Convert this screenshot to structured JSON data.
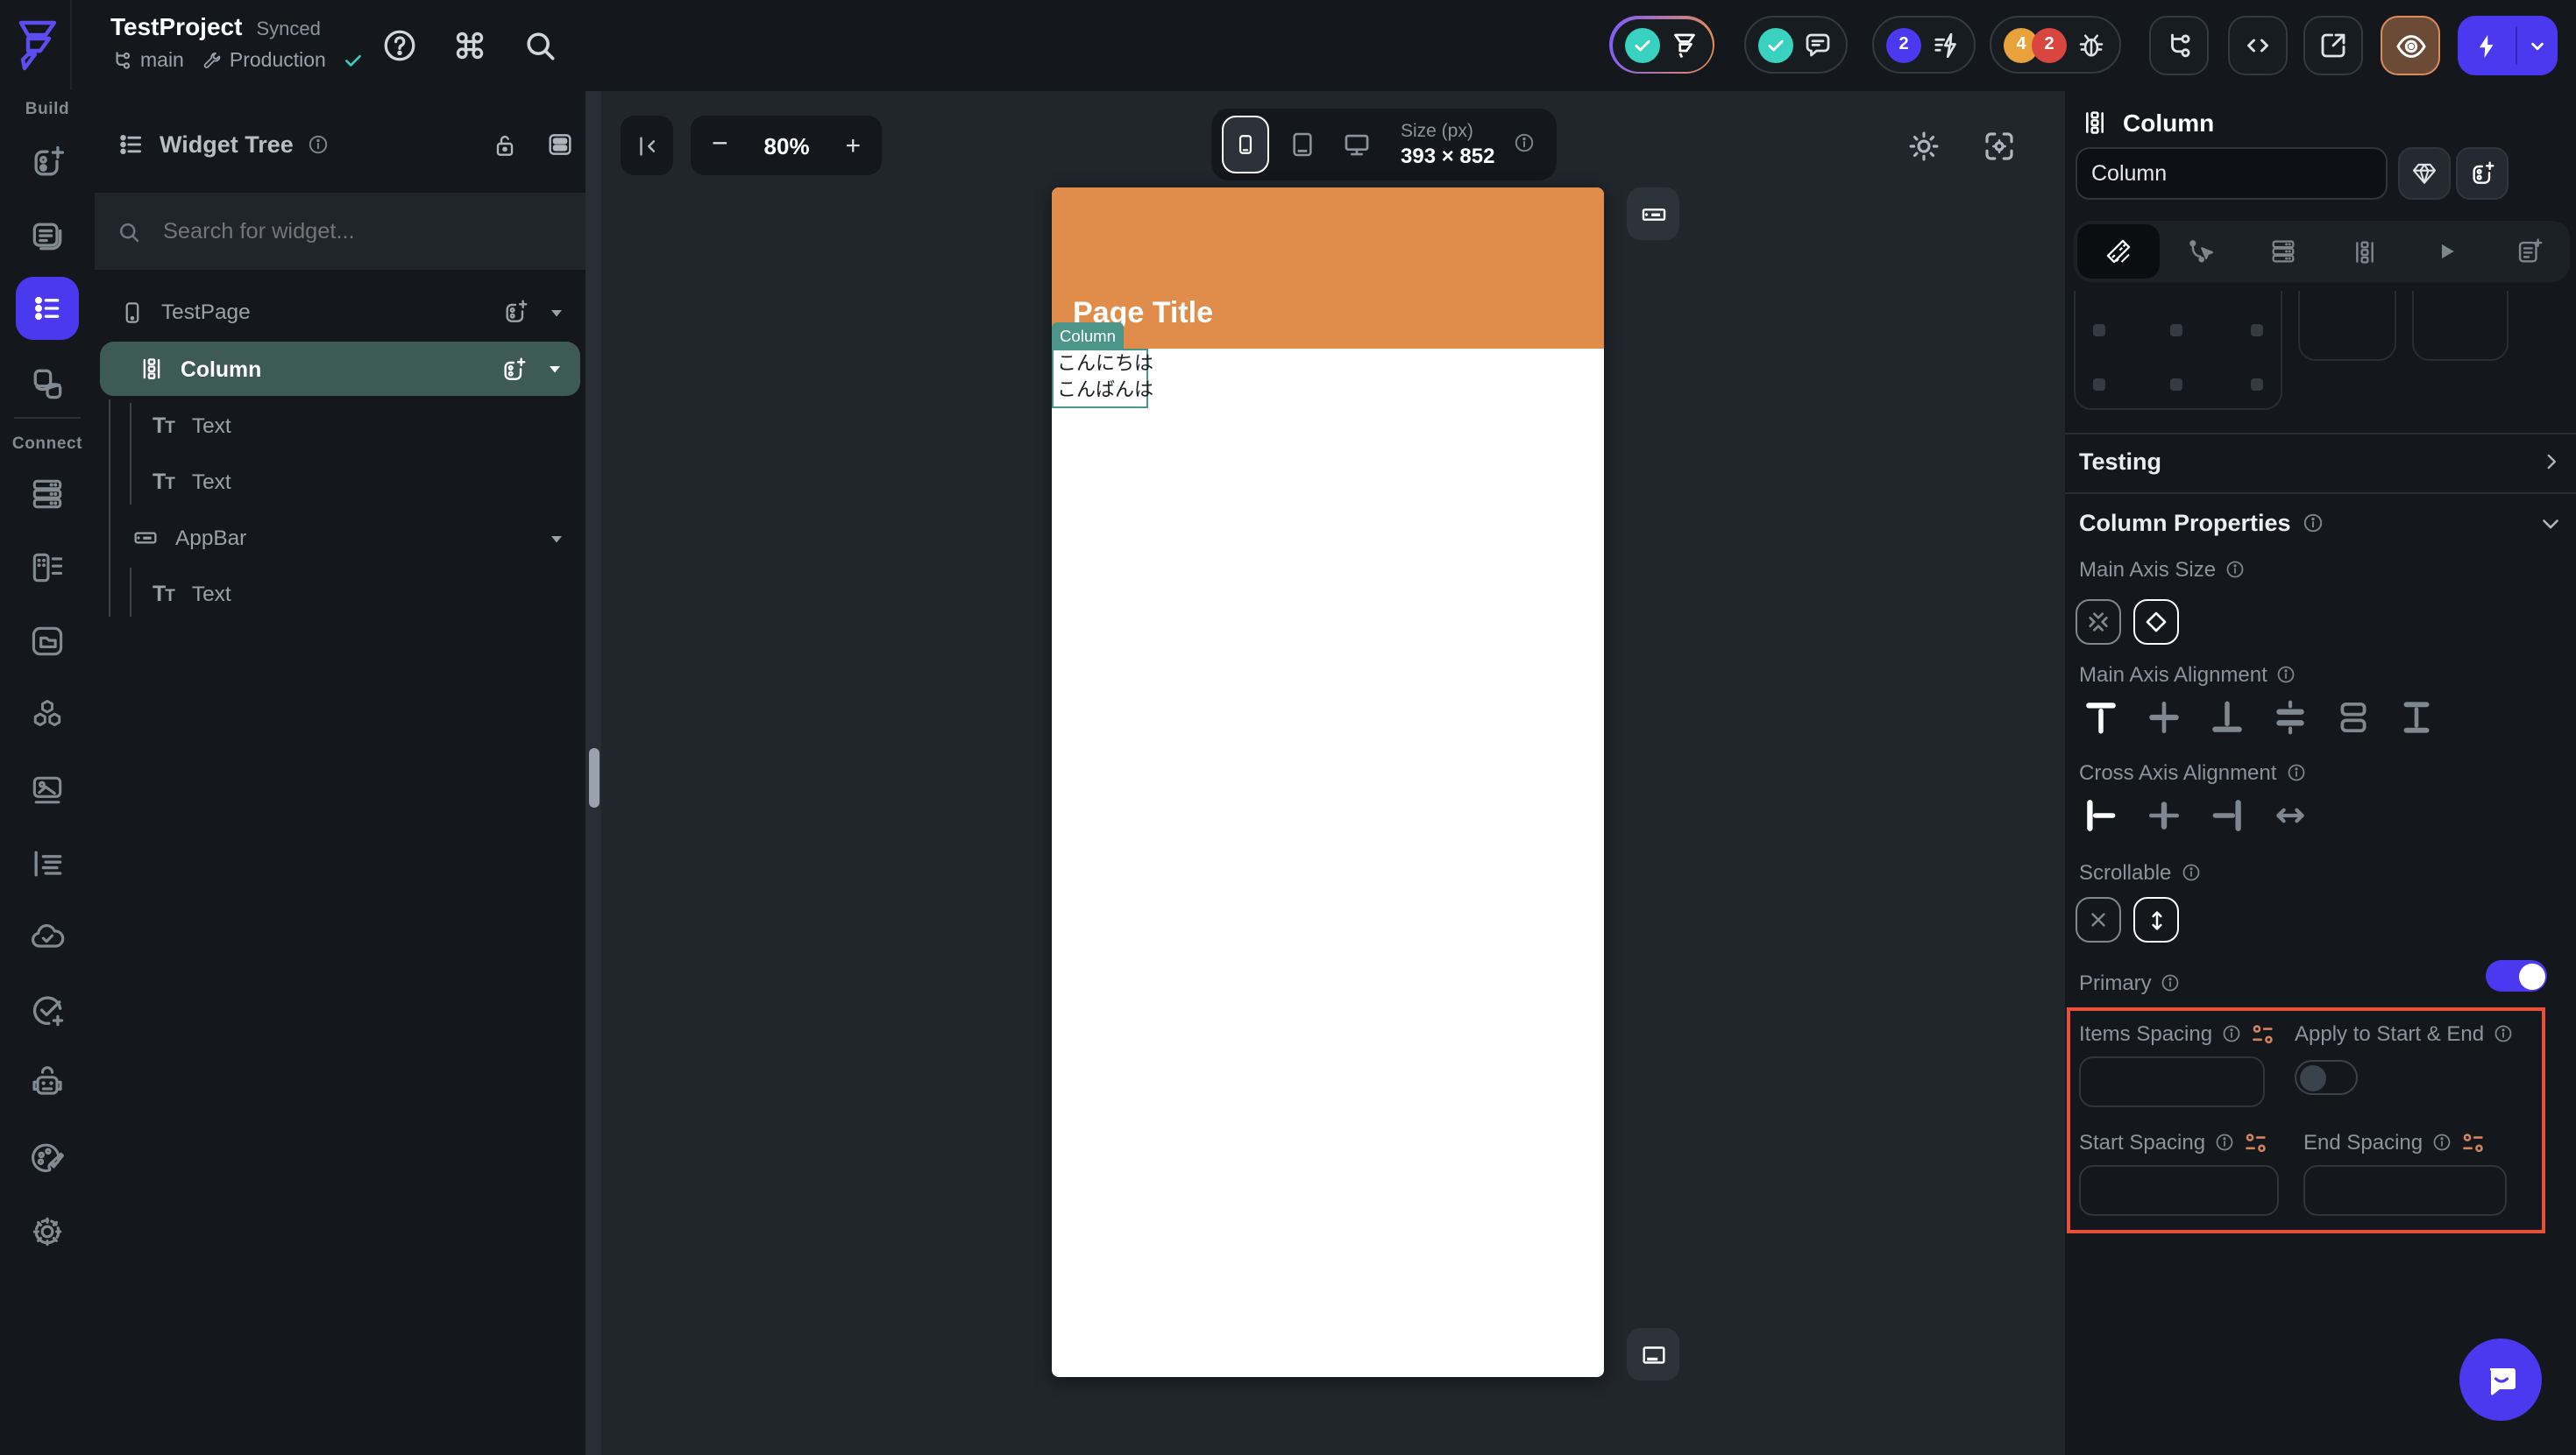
{
  "topbar": {
    "project_name": "TestProject",
    "sync_status": "Synced",
    "branch_name": "main",
    "environment": "Production",
    "badge_actions": "2",
    "badge_warnings": "4",
    "badge_errors": "2"
  },
  "nav": {
    "build_label": "Build",
    "connect_label": "Connect"
  },
  "widget_tree": {
    "title": "Widget Tree",
    "search_placeholder": "Search for widget...",
    "items": [
      {
        "label": "TestPage"
      },
      {
        "label": "Column"
      },
      {
        "label": "Text"
      },
      {
        "label": "Text"
      },
      {
        "label": "AppBar"
      },
      {
        "label": "Text"
      }
    ]
  },
  "canvas": {
    "zoom_level": "80%",
    "size_label": "Size (px)",
    "size_value": "393 × 852",
    "page_title": "Page Title",
    "selection_badge": "Column",
    "text_line_1": "こんにちは",
    "text_line_2": "こんばんは"
  },
  "properties": {
    "widget_type": "Column",
    "name_value": "Column",
    "testing_label": "Testing",
    "section_label": "Column Properties",
    "main_axis_size_label": "Main Axis Size",
    "main_axis_alignment_label": "Main Axis Alignment",
    "cross_axis_alignment_label": "Cross Axis Alignment",
    "scrollable_label": "Scrollable",
    "primary_label": "Primary",
    "items_spacing_label": "Items Spacing",
    "apply_to_start_end_label": "Apply to Start & End",
    "start_spacing_label": "Start Spacing",
    "end_spacing_label": "End Spacing",
    "items_spacing_value": "",
    "start_spacing_value": "",
    "end_spacing_value": ""
  },
  "colors": {
    "accent_indigo": "#4b39ef",
    "teal_success": "#39d2c0",
    "appbar_orange": "#e08d4b",
    "selection_teal": "#4c9689",
    "tree_selected_row": "#3d5a55",
    "highlight_red": "#e8503a",
    "variable_orange": "#d4845a",
    "badge_orange": "#e9a13b",
    "badge_red": "#d9453f"
  }
}
